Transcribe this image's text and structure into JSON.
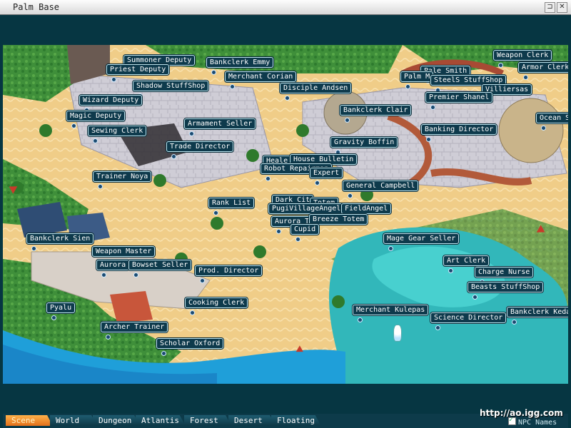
{
  "window": {
    "title": "Palm Base",
    "pin_icon": "pin-icon",
    "close_icon": "close-icon"
  },
  "map": {
    "npcs": [
      {
        "id": "summoner-deputy",
        "label": "Summoner Deputy"
      },
      {
        "id": "priest-deputy",
        "label": "Priest Deputy"
      },
      {
        "id": "bankclerk-emmy",
        "label": "Bankclerk Emmy"
      },
      {
        "id": "merchant-corian",
        "label": "Merchant Corian"
      },
      {
        "id": "shadow-stuffshop",
        "label": "Shadow StuffShop"
      },
      {
        "id": "disciple-andsen",
        "label": "Disciple Andsen"
      },
      {
        "id": "wizard-deputy",
        "label": "Wizard Deputy"
      },
      {
        "id": "magic-deputy",
        "label": "Magic Deputy"
      },
      {
        "id": "armament-seller",
        "label": "Armament Seller"
      },
      {
        "id": "sewing-clerk",
        "label": "Sewing Clerk"
      },
      {
        "id": "bankclerk-clair",
        "label": "Bankclerk Clair"
      },
      {
        "id": "gravity-boffin",
        "label": "Gravity Boffin"
      },
      {
        "id": "trade-director",
        "label": "Trade Director"
      },
      {
        "id": "heale",
        "label": "Heale"
      },
      {
        "id": "house-bulletin",
        "label": "House Bulletin"
      },
      {
        "id": "robot-repairman",
        "label": "Robot Repairman"
      },
      {
        "id": "expert",
        "label": "Expert"
      },
      {
        "id": "trainer-noya",
        "label": "Trainer Noya"
      },
      {
        "id": "general-campbell",
        "label": "General Campbell"
      },
      {
        "id": "dark-cit",
        "label": "Dark Cit"
      },
      {
        "id": "totem",
        "label": "Totem"
      },
      {
        "id": "rank-list",
        "label": "Rank List"
      },
      {
        "id": "pugi-village-angel",
        "label": "PugiVillageAngel"
      },
      {
        "id": "field-angel",
        "label": "FieldAngel"
      },
      {
        "id": "aurora-t",
        "label": "Aurora T"
      },
      {
        "id": "breeze-totem",
        "label": "Breeze Totem"
      },
      {
        "id": "cupid",
        "label": "Cupid"
      },
      {
        "id": "bankclerk-sien",
        "label": "Bankclerk Sien"
      },
      {
        "id": "mage-gear-seller",
        "label": "Mage Gear Seller"
      },
      {
        "id": "weapon-master",
        "label": "Weapon Master"
      },
      {
        "id": "aurora",
        "label": "Aurora"
      },
      {
        "id": "bowset-seller",
        "label": "Bowset Seller"
      },
      {
        "id": "prod-director",
        "label": "Prod. Director"
      },
      {
        "id": "art-clerk",
        "label": "Art Clerk"
      },
      {
        "id": "charge-nurse",
        "label": "Charge Nurse"
      },
      {
        "id": "beasts-stuffshop",
        "label": "Beasts StuffShop"
      },
      {
        "id": "cooking-clerk",
        "label": "Cooking Clerk"
      },
      {
        "id": "pyalu",
        "label": "Pyalu"
      },
      {
        "id": "merchant-kulepas",
        "label": "Merchant Kulepas"
      },
      {
        "id": "science-director",
        "label": "Science Director"
      },
      {
        "id": "bankclerk-keda",
        "label": "Bankclerk Keda"
      },
      {
        "id": "archer-trainer",
        "label": "Archer Trainer"
      },
      {
        "id": "scholar-oxford",
        "label": "Scholar Oxford"
      },
      {
        "id": "weapon-clerk",
        "label": "Weapon Clerk"
      },
      {
        "id": "armor-clerk",
        "label": "Armor Clerk"
      },
      {
        "id": "palm-m",
        "label": "Palm M"
      },
      {
        "id": "pale-smith",
        "label": "Pale Smith"
      },
      {
        "id": "steels-stuffshop",
        "label": "SteelS StuffShop"
      },
      {
        "id": "villiersas",
        "label": "Villiersas"
      },
      {
        "id": "premier-shanel",
        "label": "Premier Shanel"
      },
      {
        "id": "ocean-s",
        "label": "Ocean S"
      },
      {
        "id": "banking-director",
        "label": "Banking Director"
      }
    ]
  },
  "tabs": [
    {
      "id": "scene",
      "label": "Scene",
      "active": true
    },
    {
      "id": "world",
      "label": "World",
      "active": false
    },
    {
      "id": "dungeon",
      "label": "Dungeon",
      "active": false
    },
    {
      "id": "atlantis",
      "label": "Atlantis",
      "active": false
    },
    {
      "id": "forest",
      "label": "Forest",
      "active": false
    },
    {
      "id": "desert",
      "label": "Desert",
      "active": false
    },
    {
      "id": "floating",
      "label": "Floating",
      "active": false
    }
  ],
  "npc_names_toggle": {
    "label": "NPC Names",
    "checked": true
  },
  "watermark": "http://ao.igg.com"
}
